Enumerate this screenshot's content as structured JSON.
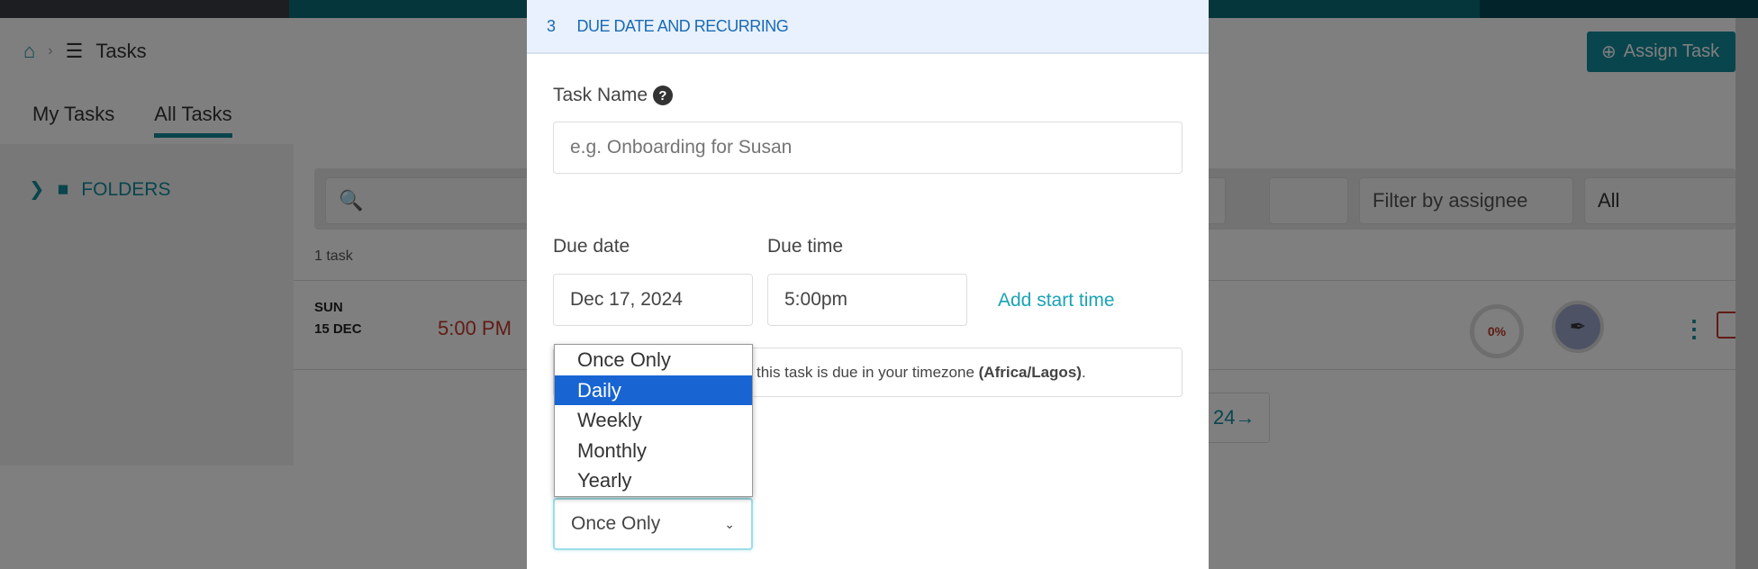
{
  "breadcrumb": {
    "home_icon": "home-icon",
    "page": "Tasks"
  },
  "tabs": [
    {
      "label": "My Tasks"
    },
    {
      "label": "All Tasks",
      "active": true
    }
  ],
  "sidebar": {
    "folders": "FOLDERS"
  },
  "toolbar": {
    "assign_task": "Assign Task",
    "filter_assignee": "Filter by assignee",
    "status_filter": "All"
  },
  "task_count": "1 task",
  "task": {
    "day": "SUN",
    "date": "15 DEC",
    "time": "5:00 PM",
    "progress": "0%"
  },
  "pager": {
    "label": "24",
    "arrow": "→"
  },
  "modal": {
    "step": "3",
    "section": "DUE DATE AND RECURRING",
    "task_name_label": "Task Name",
    "task_name_placeholder": "e.g. Onboarding for Susan",
    "due_date_label": "Due date",
    "due_date": "Dec 17, 2024",
    "due_time_label": "Due time",
    "due_time": "5:00pm",
    "add_start_time": "Add start time",
    "timezone_note": "this task is due in your timezone",
    "timezone": "(Africa/Lagos)",
    "recurrence_value": "Once Only",
    "recurrence_options": [
      "Once Only",
      "Daily",
      "Weekly",
      "Monthly",
      "Yearly"
    ],
    "highlighted_option": "Daily"
  },
  "colors": {
    "accent": "#138b9a",
    "highlight": "#1764d2",
    "header": "#1a6ab4",
    "due": "#c0392b"
  }
}
